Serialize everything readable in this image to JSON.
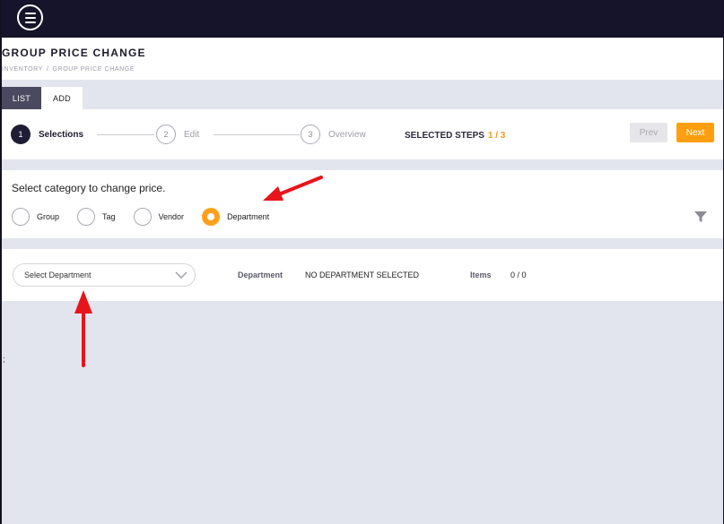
{
  "header": {
    "title": "GROUP PRICE CHANGE",
    "breadcrumb": [
      "INVENTORY",
      "GROUP PRICE CHANGE"
    ],
    "breadcrumb_sep": "/"
  },
  "tabs": [
    {
      "label": "LIST",
      "active": true
    },
    {
      "label": "ADD",
      "active": false
    }
  ],
  "steps": [
    {
      "number": "1",
      "label": "Selections",
      "active": true
    },
    {
      "number": "2",
      "label": "Edit",
      "active": false
    },
    {
      "number": "3",
      "label": "Overview",
      "active": false
    }
  ],
  "selected_steps": {
    "label": "SELECTED STEPS",
    "value": "1 / 3"
  },
  "buttons": {
    "prev": "Prev",
    "next": "Next"
  },
  "category": {
    "title": "Select category to change price.",
    "options": [
      {
        "label": "Group",
        "checked": false
      },
      {
        "label": "Tag",
        "checked": false
      },
      {
        "label": "Vendor",
        "checked": false
      },
      {
        "label": "Department",
        "checked": true
      }
    ]
  },
  "selection": {
    "placeholder": "Select Department",
    "department_label": "Department",
    "department_value": "NO DEPARTMENT SELECTED",
    "items_label": "Items",
    "items_value": "0 / 0"
  },
  "side_mark": ";",
  "colors": {
    "topbar": "#16142a",
    "accent": "#ff9f0f",
    "radio_checked": "#ffa01c",
    "annotation_arrow": "#e8141b",
    "page_background": "#e3e5ee"
  },
  "icons": [
    "menu-icon",
    "filter-icon",
    "chevron-down-icon"
  ]
}
